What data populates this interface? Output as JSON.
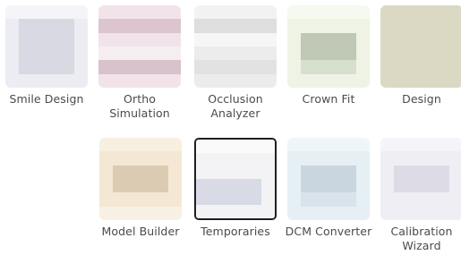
{
  "apps": [
    {
      "label": "Smile Design",
      "icon": "smile-design-icon",
      "selected": false
    },
    {
      "label": "Ortho\nSimulation",
      "icon": "ortho-simulation-icon",
      "selected": false
    },
    {
      "label": "Occlusion\nAnalyzer",
      "icon": "occlusion-analyzer-icon",
      "selected": false
    },
    {
      "label": "Crown Fit",
      "icon": "crown-fit-icon",
      "selected": false
    },
    {
      "label": "Design",
      "icon": "design-icon",
      "selected": false
    },
    {
      "label": "Model Builder",
      "icon": "model-builder-icon",
      "selected": false
    },
    {
      "label": "Temporaries",
      "icon": "temporaries-icon",
      "selected": true
    },
    {
      "label": "DCM Converter",
      "icon": "dcm-converter-icon",
      "selected": false
    },
    {
      "label": "Calibration\nWizard",
      "icon": "calibration-wizard-icon",
      "selected": false
    }
  ],
  "colors": {
    "label_text": "#4a4a4a",
    "selected_border": "#1f1f1f",
    "background": "#ffffff"
  }
}
